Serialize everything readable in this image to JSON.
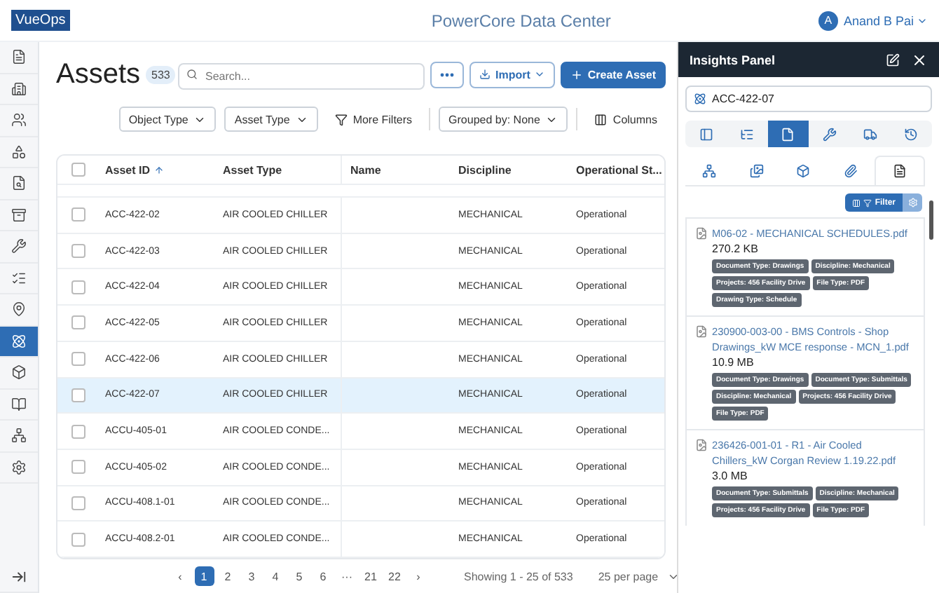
{
  "header": {
    "logo": "VueOps",
    "title": "PowerCore Data Center",
    "user": {
      "initial": "A",
      "name": "Anand B Pai"
    }
  },
  "sidebar": {
    "items": [
      {
        "selected": false
      },
      {
        "selected": false
      },
      {
        "selected": false
      },
      {
        "selected": false
      },
      {
        "selected": false
      },
      {
        "selected": false
      },
      {
        "selected": false
      },
      {
        "selected": false
      },
      {
        "selected": false
      },
      {
        "selected": true
      },
      {
        "selected": false
      },
      {
        "selected": false
      },
      {
        "selected": false
      },
      {
        "selected": false
      }
    ]
  },
  "page": {
    "title": "Assets",
    "count": "533",
    "search": {
      "placeholder": "Search..."
    },
    "import_label": "Import",
    "create_label": "Create Asset",
    "filters": [
      {
        "label": "Object Type",
        "kind": "dropdown"
      },
      {
        "label": "Asset Type",
        "kind": "dropdown"
      },
      {
        "label": "More Filters",
        "kind": "link"
      },
      {
        "label": "Grouped by: None",
        "kind": "dropdown"
      },
      {
        "label": "Columns",
        "kind": "columns"
      }
    ]
  },
  "table": {
    "select_all_checked": false,
    "columns": [
      "Asset ID",
      "Asset Type",
      "Name",
      "Discipline",
      "Operational St..."
    ],
    "rows": [
      {
        "id": "ACC-422-02",
        "type": "AIR COOLED CHILLER",
        "discipline": "MECHANICAL",
        "status": "Operational",
        "selected": false,
        "checked": false
      },
      {
        "id": "ACC-422-03",
        "type": "AIR COOLED CHILLER",
        "discipline": "MECHANICAL",
        "status": "Operational",
        "selected": false,
        "checked": false
      },
      {
        "id": "ACC-422-04",
        "type": "AIR COOLED CHILLER",
        "discipline": "MECHANICAL",
        "status": "Operational",
        "selected": false,
        "checked": false
      },
      {
        "id": "ACC-422-05",
        "type": "AIR COOLED CHILLER",
        "discipline": "MECHANICAL",
        "status": "Operational",
        "selected": false,
        "checked": false
      },
      {
        "id": "ACC-422-06",
        "type": "AIR COOLED CHILLER",
        "discipline": "MECHANICAL",
        "status": "Operational",
        "selected": false,
        "checked": false
      },
      {
        "id": "ACC-422-07",
        "type": "AIR COOLED CHILLER",
        "discipline": "MECHANICAL",
        "status": "Operational",
        "selected": true,
        "checked": false
      },
      {
        "id": "ACCU-405-01",
        "type": "AIR COOLED CONDE...",
        "discipline": "MECHANICAL",
        "status": "Operational",
        "selected": false,
        "checked": false
      },
      {
        "id": "ACCU-405-02",
        "type": "AIR COOLED CONDE...",
        "discipline": "MECHANICAL",
        "status": "Operational",
        "selected": false,
        "checked": false
      },
      {
        "id": "ACCU-408.1-01",
        "type": "AIR COOLED CONDE...",
        "discipline": "MECHANICAL",
        "status": "Operational",
        "selected": false,
        "checked": false
      },
      {
        "id": "ACCU-408.2-01",
        "type": "AIR COOLED CONDE...",
        "discipline": "MECHANICAL",
        "status": "Operational",
        "selected": false,
        "checked": false
      }
    ]
  },
  "pagination": {
    "prev": "‹",
    "next": "›",
    "pages": [
      {
        "label": "1",
        "selected": true
      },
      {
        "label": "2",
        "selected": false
      },
      {
        "label": "3",
        "selected": false
      },
      {
        "label": "4",
        "selected": false
      },
      {
        "label": "5",
        "selected": false
      },
      {
        "label": "6",
        "selected": false
      },
      {
        "label": "···",
        "selected": false
      },
      {
        "label": "21",
        "selected": false
      },
      {
        "label": "22",
        "selected": false
      }
    ],
    "showing": "Showing 1 - 25 of 533",
    "per_page": "25 per page"
  },
  "insights": {
    "title": "Insights Panel",
    "asset": "ACC-422-07",
    "tabs": [
      {
        "selected": false
      },
      {
        "selected": false
      },
      {
        "selected": true
      },
      {
        "selected": false
      },
      {
        "selected": false
      },
      {
        "selected": false
      }
    ],
    "subtabs": [
      {
        "selected": false
      },
      {
        "selected": false
      },
      {
        "selected": false
      },
      {
        "selected": false
      },
      {
        "selected": true
      }
    ],
    "filter_label": "Filter",
    "documents": [
      {
        "name": "M06-02 - MECHANICAL SCHEDULES.pdf",
        "size": "270.2 KB",
        "tags": [
          "Document Type: Drawings",
          "Discipline: Mechanical",
          "Projects: 456 Facility Drive",
          "File Type: PDF",
          "Drawing Type: Schedule"
        ]
      },
      {
        "name": "230900-003-00 - BMS Controls - Shop Drawings_kW MCE response - MCN_1.pdf",
        "size": "10.9 MB",
        "tags": [
          "Document Type: Drawings",
          "Document Type: Submittals",
          "Discipline: Mechanical",
          "Projects: 456 Facility Drive",
          "File Type: PDF"
        ]
      },
      {
        "name": "236426-001-01 - R1 - Air Cooled Chillers_kW Corgan Review 1.19.22.pdf",
        "size": "3.0 MB",
        "tags": [
          "Document Type: Submittals",
          "Discipline: Mechanical",
          "Projects: 456 Facility Drive",
          "File Type: PDF"
        ]
      }
    ]
  }
}
